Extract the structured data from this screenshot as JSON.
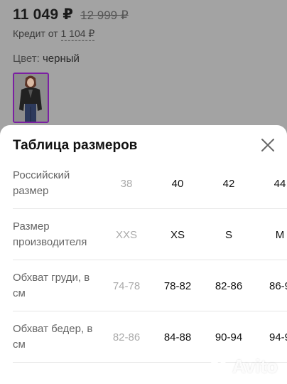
{
  "product": {
    "price": "11 049 ₽",
    "old_price": "12 999 ₽",
    "credit_prefix": "Кредит от",
    "credit_amount": "1 104 ₽",
    "color_label": "Цвет:",
    "color_value": "черный"
  },
  "size_sheet": {
    "title": "Таблица размеров",
    "rows": [
      {
        "label": "Российский размер",
        "values": [
          "38",
          "40",
          "42",
          "44"
        ]
      },
      {
        "label": "Размер производителя",
        "values": [
          "XXS",
          "XS",
          "S",
          "M"
        ]
      },
      {
        "label": "Обхват груди, в см",
        "values": [
          "74-78",
          "78-82",
          "82-86",
          "86-9"
        ]
      },
      {
        "label": "Обхват бедер, в см",
        "values": [
          "82-86",
          "84-88",
          "90-94",
          "94-9"
        ]
      }
    ]
  },
  "watermark": {
    "text": "Avito"
  },
  "colors": {
    "accent": "#7b1fa2",
    "muted": "#aaaaaa"
  }
}
